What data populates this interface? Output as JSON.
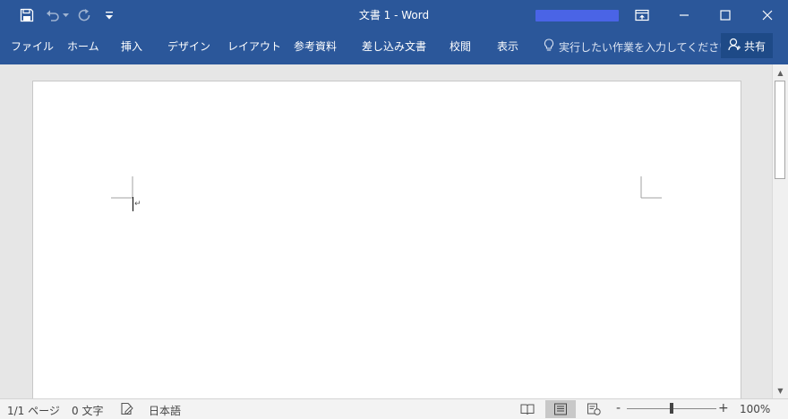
{
  "title_bar": {
    "title": "文書 1 - Word",
    "quick_access": [
      {
        "name": "save-icon"
      },
      {
        "name": "undo-icon"
      },
      {
        "name": "undo-dropdown-icon"
      },
      {
        "name": "redo-icon"
      },
      {
        "name": "customize-qat-icon"
      }
    ],
    "window_controls": [
      {
        "name": "ribbon-display-options-icon"
      },
      {
        "name": "minimize-icon"
      },
      {
        "name": "maximize-icon"
      },
      {
        "name": "close-icon"
      }
    ]
  },
  "ribbon": {
    "tabs": [
      "ファイル",
      "ホーム",
      "挿入",
      "デザイン",
      "レイアウト",
      "参考資料",
      "差し込み文書",
      "校閲",
      "表示"
    ],
    "tell_me": "実行したい作業を入力してください",
    "share": "共有"
  },
  "status_bar": {
    "page": "1/1 ページ",
    "words": "0 文字",
    "language": "日本語",
    "zoom": "100%",
    "zoom_minus": "-",
    "zoom_plus": "+",
    "zoom_fraction": 0.5
  },
  "colors": {
    "accent": "#2b579a",
    "share_button": "#1e4a87"
  }
}
